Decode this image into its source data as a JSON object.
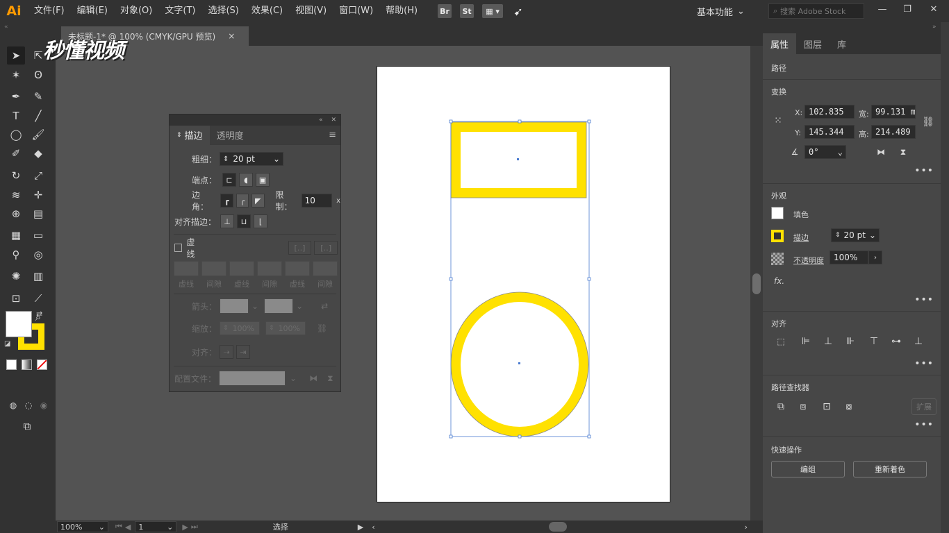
{
  "app": {
    "logo": "Ai"
  },
  "menu": [
    "文件(F)",
    "编辑(E)",
    "对象(O)",
    "文字(T)",
    "选择(S)",
    "效果(C)",
    "视图(V)",
    "窗口(W)",
    "帮助(H)"
  ],
  "menubar_icons": {
    "bridge": "Br",
    "stock": "St"
  },
  "workspace": {
    "label": "基本功能"
  },
  "stock_search": {
    "placeholder": "搜索 Adobe Stock"
  },
  "document": {
    "tab_title": "未标题-1* @ 100% (CMYK/GPU 预览)",
    "close": "×"
  },
  "watermark": "秒懂视频",
  "statusbar": {
    "zoom": "100%",
    "artboard": "1",
    "tool": "选择"
  },
  "stroke_panel": {
    "tab_stroke": "描边",
    "tab_transparency": "透明度",
    "weight_label": "粗细：",
    "weight_value": "20 pt",
    "cap_label": "端点：",
    "corner_label": "边角：",
    "limit_label": "限制：",
    "limit_value": "10",
    "limit_unit": "x",
    "align_label": "对齐描边：",
    "dashed_label": "虚线",
    "dash_labels": [
      "虚线",
      "间隙",
      "虚线",
      "间隙",
      "虚线",
      "间隙"
    ],
    "arrowheads_label": "箭头：",
    "scale_label": "缩放：",
    "scale_value_1": "100%",
    "scale_value_2": "100%",
    "align_arrow_label": "对齐：",
    "profile_label": "配置文件："
  },
  "properties": {
    "tab_properties": "属性",
    "tab_layers": "图层",
    "tab_libraries": "库",
    "object_type": "路径",
    "transform_title": "变换",
    "x_label": "X:",
    "x_value": "102.835",
    "y_label": "Y:",
    "y_value": "145.344",
    "w_label": "宽:",
    "w_value": "99.131 m",
    "h_label": "高:",
    "h_value": "214.489",
    "angle_value": "0°",
    "appearance_title": "外观",
    "fill_label": "填色",
    "stroke_label": "描边",
    "stroke_value": "20 pt",
    "opacity_label": "不透明度",
    "opacity_value": "100%",
    "fx_label": "fx.",
    "align_title": "对齐",
    "pathfinder_title": "路径查找器",
    "expand_label": "扩展",
    "quick_actions_title": "快速操作",
    "group_button": "编组",
    "recolor_button": "重新着色"
  },
  "colors": {
    "stroke_yellow": "#ffe100",
    "selection_blue": "#4a7bd0",
    "app_orange": "#ff9a00"
  }
}
